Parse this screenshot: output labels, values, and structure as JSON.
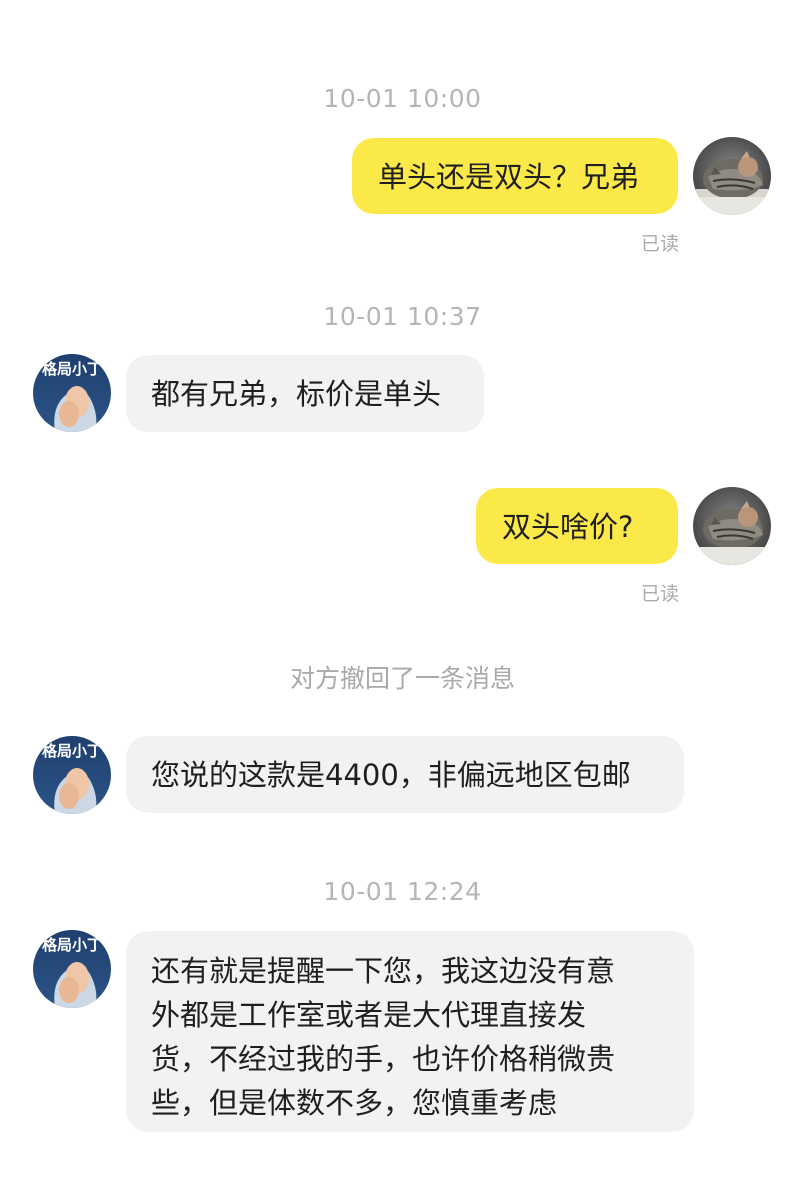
{
  "colors": {
    "self_bubble": "#fbe94a",
    "other_bubble": "#f2f2f4",
    "timestamp_text": "#b5b5b5"
  },
  "timestamps": [
    "10-01 10:00",
    "10-01 10:37",
    "10-01 12:24"
  ],
  "system_notice": "对方撤回了一条消息",
  "other_avatar_text": "格局小丁",
  "messages": [
    {
      "sender": "self",
      "text": "单头还是双头？兄弟",
      "status": "已读",
      "avatar": "cat-avatar-icon"
    },
    {
      "sender": "other",
      "text": "都有兄弟，标价是单头",
      "avatar": "seller-avatar-icon"
    },
    {
      "sender": "self",
      "text": "双头啥价?",
      "status": "已读",
      "avatar": "cat-avatar-icon"
    },
    {
      "sender": "other",
      "text": "您说的这款是4400，非偏远地区包邮",
      "avatar": "seller-avatar-icon"
    },
    {
      "sender": "other",
      "lines": [
        "还有就是提醒一下您，我这边没有意",
        "外都是工作室或者是大代理直接发",
        "货，不经过我的手，也许价格稍微贵",
        "些，但是体数不多，您慎重考虑"
      ],
      "avatar": "seller-avatar-icon"
    }
  ]
}
